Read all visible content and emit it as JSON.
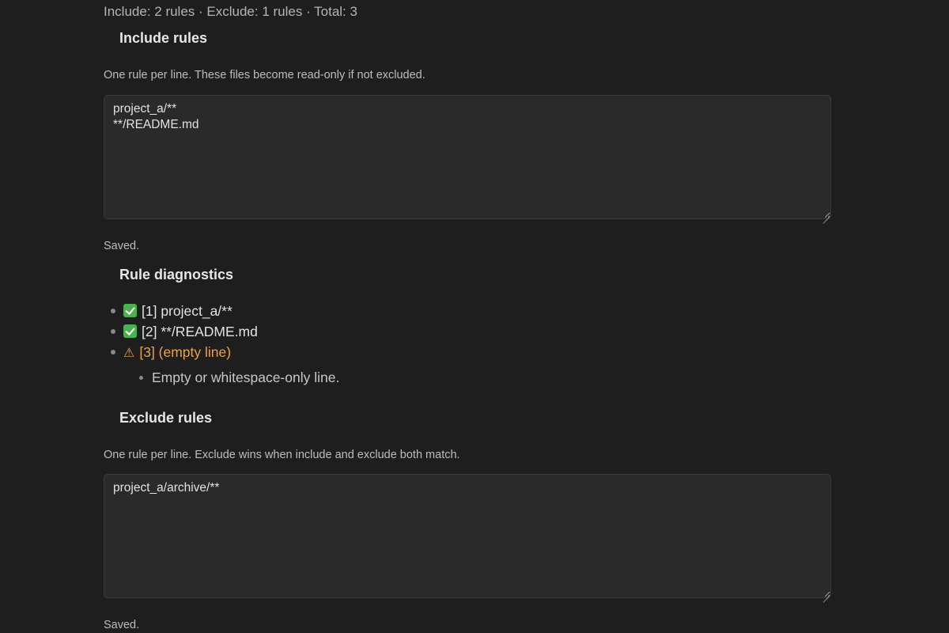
{
  "summary": "Include: 2 rules · Exclude: 1 rules · Total: 3",
  "include": {
    "heading": "Include rules",
    "description": "One rule per line. These files become read-only if not excluded.",
    "value": "project_a/**\n**/README.md",
    "status": "Saved."
  },
  "diagnostics": {
    "heading": "Rule diagnostics",
    "items": [
      {
        "text": "[1] project_a/**",
        "state": "ok"
      },
      {
        "text": "[2] **/README.md",
        "state": "ok"
      },
      {
        "text": "[3] (empty line)",
        "state": "warning",
        "detail": "Empty or whitespace-only line."
      }
    ]
  },
  "exclude": {
    "heading": "Exclude rules",
    "description": "One rule per line. Exclude wins when include and exclude both match.",
    "value": "project_a/archive/**",
    "status": "Saved."
  },
  "colors": {
    "background": "#1e1e1e",
    "warning": "#e8a24a",
    "ok": "#4caf50"
  }
}
